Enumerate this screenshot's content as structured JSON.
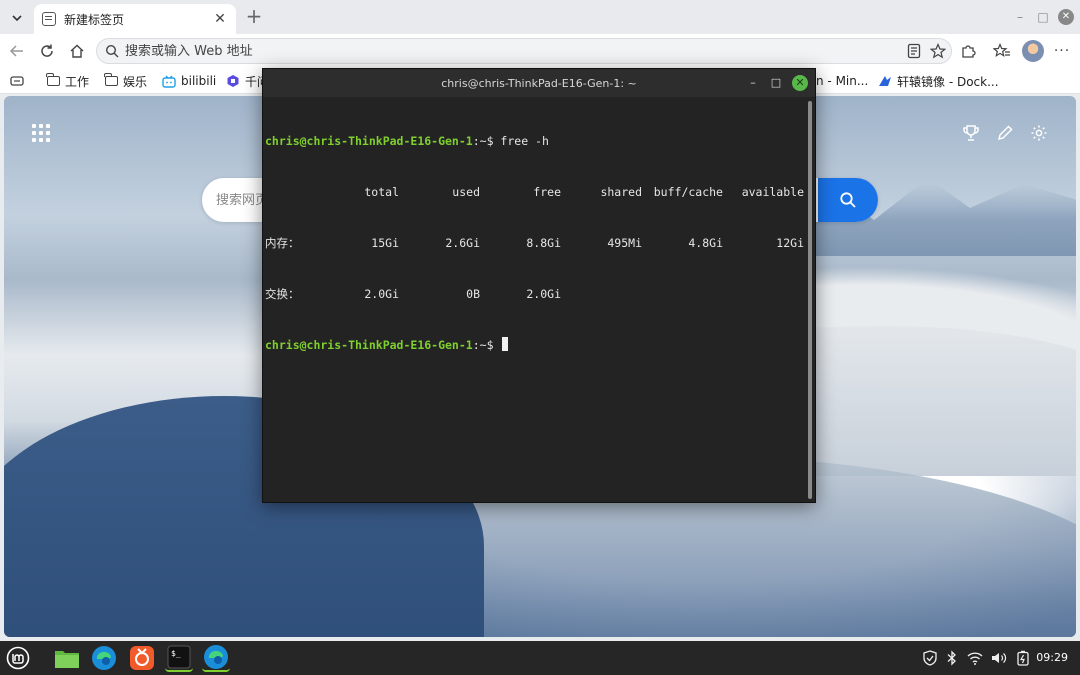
{
  "browser": {
    "tab": {
      "title": "新建标签页"
    },
    "address": {
      "placeholder": "搜索或输入 Web 地址"
    },
    "bookmarks": [
      {
        "label": "工作",
        "icon": "folder-icon"
      },
      {
        "label": "娱乐",
        "icon": "folder-icon"
      },
      {
        "label": "bilibili",
        "icon": "bilibili-icon"
      },
      {
        "label": "千问",
        "icon": "qianwen-icon"
      },
      {
        "label": "n - Min...",
        "icon": "site-icon"
      },
      {
        "label": "轩辕镜像 - Dock...",
        "icon": "xuanyuan-icon"
      }
    ]
  },
  "newtab": {
    "search_placeholder": "搜索网页"
  },
  "terminal": {
    "title": "chris@chris-ThinkPad-E16-Gen-1: ~",
    "prompt_user": "chris@chris-ThinkPad-E16-Gen-1",
    "prompt_suffix": ":~$",
    "command": " free -h",
    "table": {
      "headers": [
        "",
        "total",
        "used",
        "free",
        "shared",
        "buff/cache",
        "available"
      ],
      "rows": [
        [
          "内存：",
          "15Gi",
          "2.6Gi",
          "8.8Gi",
          "495Mi",
          "4.8Gi",
          "12Gi"
        ],
        [
          "交换：",
          "2.0Gi",
          "0B",
          "2.0Gi",
          "",
          "",
          ""
        ]
      ]
    }
  },
  "taskbar": {
    "clock": "09:29"
  },
  "colors": {
    "prompt_green": "#7fcf2e",
    "accent_blue": "#1b73e8",
    "terminal_bg": "#232323"
  }
}
